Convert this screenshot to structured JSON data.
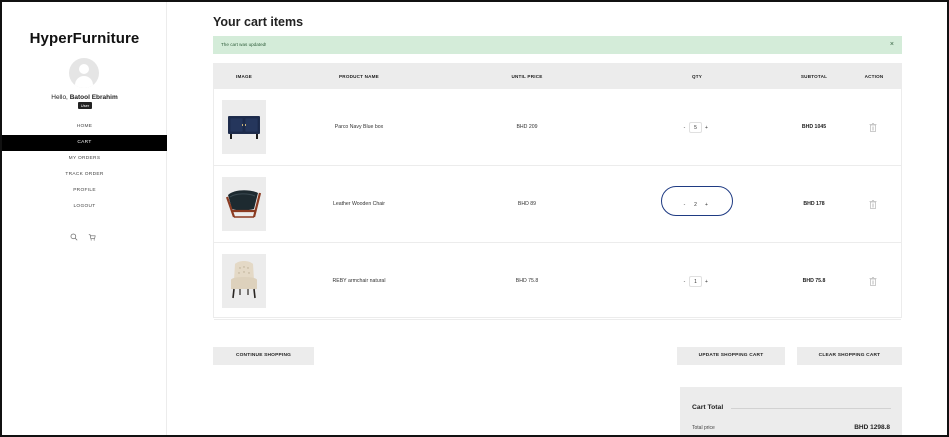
{
  "sidebar": {
    "logo": "HyperFurniture",
    "greeting_prefix": "Hello, ",
    "user_name": "Batool Ebrahim",
    "role": "User",
    "nav": [
      {
        "label": "HOME"
      },
      {
        "label": "CART"
      },
      {
        "label": "MY ORDERS"
      },
      {
        "label": "TRACK ORDER"
      },
      {
        "label": "PROFILE"
      },
      {
        "label": "LOGOUT"
      }
    ],
    "active_nav": "CART",
    "icons": [
      "search-icon",
      "cart-icon"
    ]
  },
  "main": {
    "title": "Your cart items",
    "alert": {
      "message": "The cart was updated!",
      "close": "×"
    },
    "table": {
      "headers": {
        "image": "IMAGE",
        "product_name": "PRODUCT NAME",
        "unit_price": "UNTIL PRICE",
        "qty": "QTY",
        "subtotal": "SUBTOTAL",
        "action": "ACTION"
      },
      "rows": [
        {
          "product": "Parco Navy Blue box",
          "price": "BHD 209",
          "qty": "5",
          "subtotal": "BHD 1045",
          "image": "navy-cabinet-image"
        },
        {
          "product": "Leather Wooden Chair",
          "price": "BHD 89",
          "qty": "2",
          "subtotal": "BHD 178",
          "image": "leather-chair-image"
        },
        {
          "product": "REBY armchair natural",
          "price": "BHD 75.8",
          "qty": "1",
          "subtotal": "BHD 75.8",
          "image": "tufted-armchair-image"
        }
      ],
      "qty_minus": "-",
      "qty_plus": "+"
    },
    "buttons": {
      "continue": "CONTINUE SHOPPING",
      "update": "UPDATE SHOPPING CART",
      "clear": "CLEAR SHOPPING CART"
    },
    "cart_total": {
      "title": "Cart Total",
      "total_label": "Total price",
      "total_value": "BHD 1298.8"
    }
  },
  "colors": {
    "accent": "#000000",
    "alert_bg": "#d4ecd9",
    "panel_bg": "#ececec",
    "focus_ring": "#1f3b83"
  }
}
